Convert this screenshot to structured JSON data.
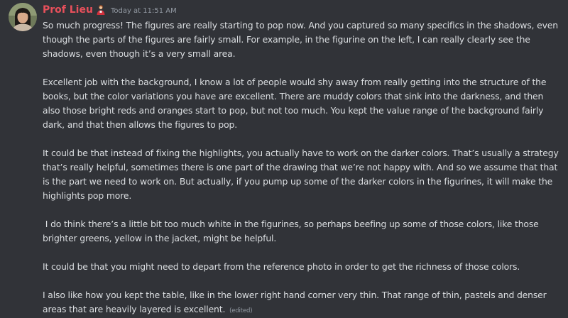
{
  "author": {
    "name": "Prof Lieu"
  },
  "timestamp": "Today at 11:51 AM",
  "paragraphs": [
    "So much progress! The figures are really starting to pop now. And you captured so many specifics in the shadows, even though the parts of the figures are fairly small. For example, in the figurine on the left, I can really clearly see the shadows, even though it’s a very small area.",
    "Excellent job with the background, I know a lot of people would shy away from really getting into the structure of the books, but the color variations you have are excellent. There are muddy colors that sink into the darkness, and then also those bright reds and oranges start to pop, but not too much. You kept the value range of the background fairly dark, and that then allows the figures to pop.",
    "It could be that instead of fixing the highlights, you actually have to work on the darker colors. That’s usually a strategy that’s really helpful, sometimes there is one part of the drawing that we’re not happy with. And so we assume that that is the part we need to work on. But actually, if you pump up some of the darker colors in the figurines, it will make the highlights pop more.",
    " I do think there’s a little bit too much white in the figurines, so perhaps beefing up some of those colors, like those brighter greens, yellow in the jacket, might be helpful.",
    "It could be that you might need to depart from the reference photo in order to get the richness of those colors.",
    "I also like how you kept the table, like in the lower right hand corner very thin. That range of thin, pastels and denser areas that are heavily layered is excellent."
  ],
  "edited_label": "(edited)",
  "colors": {
    "background": "#313338",
    "username": "#e8505b",
    "text": "#dbdee1",
    "muted": "#949ba4"
  },
  "icons": {
    "avatar": "user-avatar",
    "role": "role-icon"
  }
}
